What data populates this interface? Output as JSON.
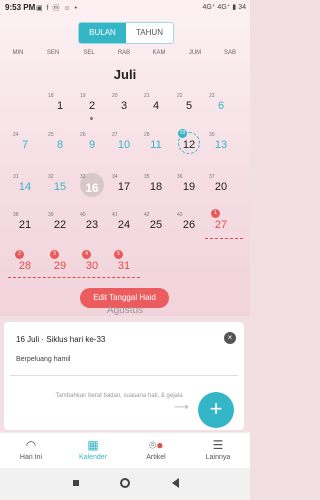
{
  "status": {
    "time": "9:53 PM",
    "right": "4G⁺ 4G⁺ ▮ 34"
  },
  "segment": {
    "month": "BULAN",
    "year": "TAHUN"
  },
  "weekdays": [
    "MIN",
    "SEN",
    "SEL",
    "RAB",
    "KAM",
    "JUM",
    "SAB"
  ],
  "month_title": "Juli",
  "next_month": "Agustus",
  "weeks": [
    [
      {
        "s": "",
        "n": ""
      },
      {
        "s": "18",
        "n": "1"
      },
      {
        "s": "19",
        "n": "2"
      },
      {
        "s": "20",
        "n": "3"
      },
      {
        "s": "21",
        "n": "4"
      },
      {
        "s": "22",
        "n": "5"
      },
      {
        "s": "23",
        "n": "6",
        "t": "teal"
      }
    ],
    [
      {
        "s": "24",
        "n": "7",
        "t": "teal"
      },
      {
        "s": "25",
        "n": "8",
        "t": "teal"
      },
      {
        "s": "26",
        "n": "9",
        "t": "teal"
      },
      {
        "s": "27",
        "n": "10",
        "t": "teal"
      },
      {
        "s": "28",
        "n": "11",
        "t": "teal"
      },
      {
        "s": "29",
        "n": "12",
        "t": "ov"
      },
      {
        "s": "30",
        "n": "13",
        "t": "teal"
      }
    ],
    [
      {
        "s": "31",
        "n": "14",
        "t": "teal"
      },
      {
        "s": "32",
        "n": "15",
        "t": "teal"
      },
      {
        "s": "33",
        "n": "16",
        "t": "today"
      },
      {
        "s": "34",
        "n": "17"
      },
      {
        "s": "35",
        "n": "18"
      },
      {
        "s": "36",
        "n": "19"
      },
      {
        "s": "37",
        "n": "20"
      }
    ],
    [
      {
        "s": "38",
        "n": "21"
      },
      {
        "s": "39",
        "n": "22"
      },
      {
        "s": "40",
        "n": "23"
      },
      {
        "s": "41",
        "n": "24"
      },
      {
        "s": "42",
        "n": "25"
      },
      {
        "s": "43",
        "n": "26"
      },
      {
        "s": "1",
        "n": "27",
        "t": "red"
      }
    ],
    [
      {
        "s": "2",
        "n": "28",
        "t": "red"
      },
      {
        "s": "3",
        "n": "29",
        "t": "red"
      },
      {
        "s": "4",
        "n": "30",
        "t": "red"
      },
      {
        "s": "5",
        "n": "31",
        "t": "red"
      },
      {
        "s": "",
        "n": ""
      },
      {
        "s": "",
        "n": ""
      },
      {
        "s": "",
        "n": ""
      }
    ]
  ],
  "edit_button": "Edit Tanggal Haid",
  "card": {
    "title": "16 Juli · Siklus hari ke-33",
    "status": "Berpeluang hamil",
    "hint": "Tambahkan berat badan, suasana hati, & gejala"
  },
  "nav": {
    "today": "Hari Ini",
    "calendar": "Kalender",
    "article": "Artikel",
    "more": "Lainnya"
  },
  "colors": {
    "accent": "#35b6c6",
    "period": "#e24b4b",
    "button": "#ec5c5f"
  }
}
